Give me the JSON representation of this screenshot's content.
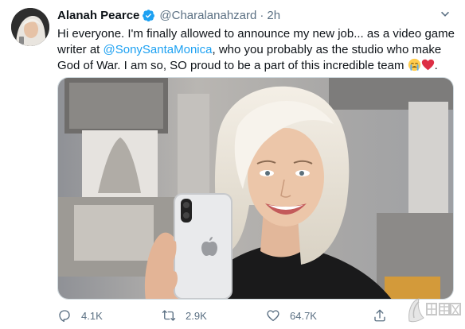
{
  "tweet": {
    "author_name": "Alanah Pearce",
    "handle": "@Charalanahzard",
    "separator": "·",
    "time": "2h",
    "text_line1": "Hi everyone. I'm finally allowed to announce my new job... as a video game",
    "text_line2_a": "writer at ",
    "mention": "@SonySantaMonica",
    "text_line2_b": ", who you probably as the studio who make",
    "text_line3": "God of War. I am so, SO proud to be a part of this incredible team",
    "text_end": ".",
    "emojis": [
      "crying-face",
      "red-heart"
    ]
  },
  "actions": {
    "reply_count": "4.1K",
    "retweet_count": "2.9K",
    "like_count": "64.7K"
  },
  "colors": {
    "accent": "#1da1f2",
    "secondary_text": "#5b7083",
    "primary_text": "#0f1419",
    "heart": "#e0245e"
  },
  "icons": [
    "verified-badge-icon",
    "more-icon",
    "reply-icon",
    "retweet-icon",
    "like-icon",
    "share-icon"
  ]
}
